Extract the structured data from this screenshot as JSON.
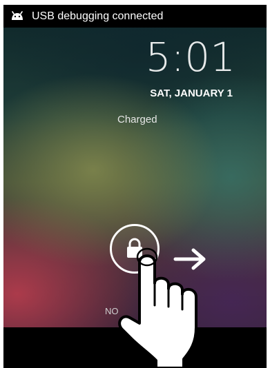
{
  "status_bar": {
    "icon": "android-debug-icon",
    "text": "USB debugging connected"
  },
  "lockscreen": {
    "time": "5:01",
    "date": "SAT, JANUARY 1",
    "charge_status": "Charged",
    "carrier_text": "NO",
    "unlock_control": {
      "icon": "lock-icon",
      "direction_icon": "arrow-right-icon"
    }
  },
  "overlay": {
    "gesture_icon": "hand-pointer-icon"
  },
  "colors": {
    "status_bar_bg": "#000000",
    "text": "#ffffff"
  }
}
